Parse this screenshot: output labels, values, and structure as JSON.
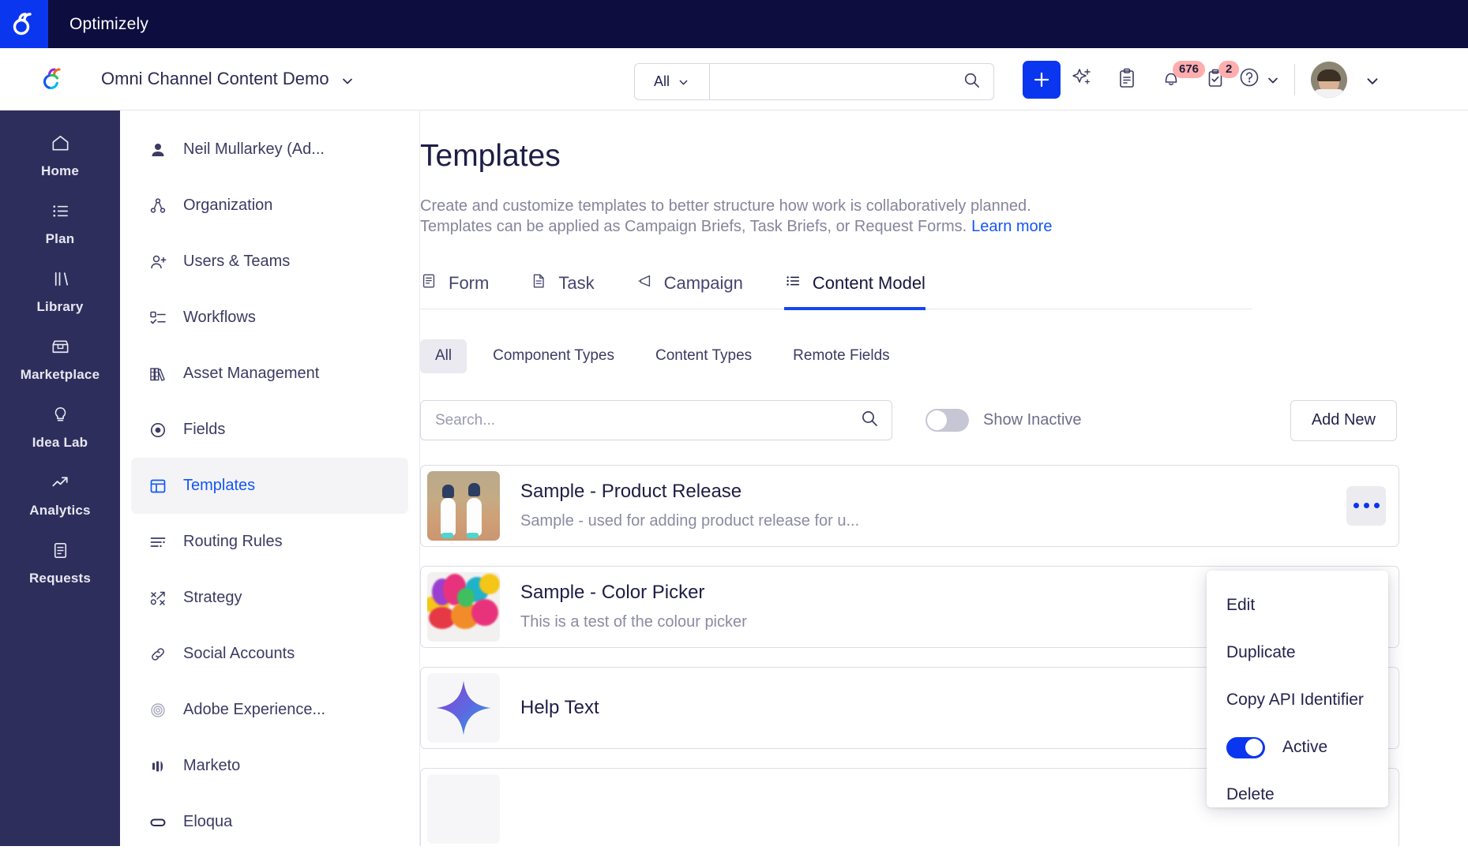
{
  "topbar": {
    "title": "Optimizely",
    "logo_icon": "optimizely-logo-icon"
  },
  "header": {
    "workspace": "Omni Channel Content Demo",
    "workspace_chevron_icon": "chevron-down-icon",
    "brand_icon": "optimizely-brand-icon",
    "search": {
      "scope_label": "All",
      "scope_chevron_icon": "chevron-down-icon",
      "value": "",
      "placeholder": "",
      "search_icon": "search-icon"
    },
    "actions": {
      "create_label": "+",
      "create_icon": "plus-icon",
      "ai_icon": "sparkle-icon",
      "clipboard_icon": "clipboard-icon",
      "notifications_icon": "bell-icon",
      "notifications_count": "676",
      "tasks_icon": "task-checklist-icon",
      "tasks_count": "2",
      "help_icon": "question-circle-icon",
      "help_chevron_icon": "chevron-down-icon",
      "avatar_icon": "user-avatar",
      "account_chevron_icon": "chevron-down-icon"
    }
  },
  "rail": {
    "items": [
      {
        "label": "Home",
        "icon": "home-icon"
      },
      {
        "label": "Plan",
        "icon": "list-icon"
      },
      {
        "label": "Library",
        "icon": "books-icon"
      },
      {
        "label": "Marketplace",
        "icon": "storefront-icon"
      },
      {
        "label": "Idea Lab",
        "icon": "lightbulb-icon"
      },
      {
        "label": "Analytics",
        "icon": "trend-up-icon"
      },
      {
        "label": "Requests",
        "icon": "document-icon"
      }
    ]
  },
  "subnav": {
    "items": [
      {
        "label": "Neil Mullarkey (Ad...",
        "icon": "person-icon",
        "active": false
      },
      {
        "label": "Organization",
        "icon": "org-chart-icon",
        "active": false
      },
      {
        "label": "Users & Teams",
        "icon": "user-add-icon",
        "active": false
      },
      {
        "label": "Workflows",
        "icon": "workflow-icon",
        "active": false
      },
      {
        "label": "Asset Management",
        "icon": "books-shelf-icon",
        "active": false
      },
      {
        "label": "Fields",
        "icon": "target-icon",
        "active": false
      },
      {
        "label": "Templates",
        "icon": "template-layout-icon",
        "active": true
      },
      {
        "label": "Routing Rules",
        "icon": "routing-icon",
        "active": false
      },
      {
        "label": "Strategy",
        "icon": "strategy-icon",
        "active": false
      },
      {
        "label": "Social Accounts",
        "icon": "link-icon",
        "active": false
      },
      {
        "label": "Adobe Experience...",
        "icon": "adobe-icon",
        "active": false
      },
      {
        "label": "Marketo",
        "icon": "marketo-icon",
        "active": false
      },
      {
        "label": "Eloqua",
        "icon": "eloqua-icon",
        "active": false
      }
    ]
  },
  "main": {
    "title": "Templates",
    "description_line1": "Create and customize templates to better structure how work is collaboratively planned.",
    "description_line2": "Templates can be applied as Campaign Briefs, Task Briefs, or Request Forms.",
    "learn_more": "Learn more",
    "tabs": [
      {
        "label": "Form",
        "icon": "form-icon",
        "active": false
      },
      {
        "label": "Task",
        "icon": "task-doc-icon",
        "active": false
      },
      {
        "label": "Campaign",
        "icon": "megaphone-icon",
        "active": false
      },
      {
        "label": "Content Model",
        "icon": "list-lines-icon",
        "active": true
      }
    ],
    "filters": [
      {
        "label": "All",
        "active": true
      },
      {
        "label": "Component Types",
        "active": false
      },
      {
        "label": "Content Types",
        "active": false
      },
      {
        "label": "Remote Fields",
        "active": false
      }
    ],
    "toolbar": {
      "search_value": "",
      "search_placeholder": "Search...",
      "search_icon": "search-icon",
      "show_inactive_label": "Show Inactive",
      "show_inactive_on": false,
      "add_new_label": "Add New"
    },
    "cards": [
      {
        "title": "Sample - Product Release",
        "description": "Sample - used for adding product release for u...",
        "thumb": "booby-birds-photo",
        "menu_icon": "more-options-icon"
      },
      {
        "title": "Sample - Color Picker",
        "description": "This is a test of the colour picker",
        "thumb": "color-paint-photo",
        "menu_icon": "more-options-icon"
      },
      {
        "title": "Help Text",
        "description": "",
        "thumb": "sparkle-gradient-icon",
        "menu_icon": "more-options-icon"
      },
      {
        "title": "",
        "description": "",
        "thumb": "placeholder-thumb",
        "menu_icon": "more-options-icon"
      }
    ]
  },
  "context_menu": {
    "items": [
      {
        "label": "Edit",
        "type": "action"
      },
      {
        "label": "Duplicate",
        "type": "action"
      },
      {
        "label": "Copy API Identifier",
        "type": "action"
      },
      {
        "label": "Active",
        "type": "toggle",
        "on": true
      },
      {
        "label": "Delete",
        "type": "action"
      }
    ]
  },
  "colors": {
    "brand_blue": "#0b36f0",
    "link_blue": "#1356f7",
    "topbar_navy": "#0d0d3f",
    "rail_navy": "#2e2e5c",
    "badge_pink": "#ffadad",
    "text_dark": "#1d1d45",
    "text_muted": "#8b8ba2"
  }
}
